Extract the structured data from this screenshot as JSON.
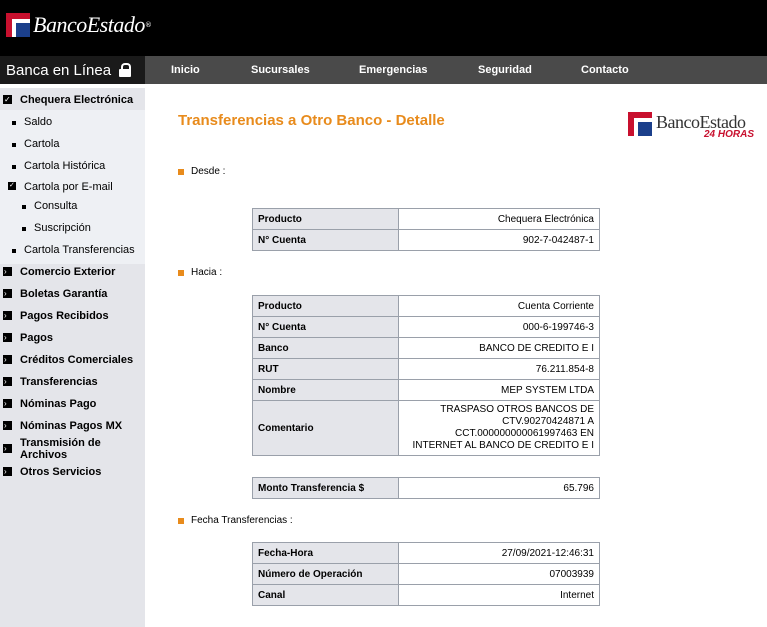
{
  "brand": {
    "name": "BancoEstado",
    "reg": "®"
  },
  "banca_en_linea": "Banca en Línea",
  "topnav": [
    "Inicio",
    "Sucursales",
    "Emergencias",
    "Seguridad",
    "Contacto"
  ],
  "sidebar": {
    "chequera": "Chequera Electrónica",
    "saldo": "Saldo",
    "cartola": "Cartola",
    "cartola_historica": "Cartola Histórica",
    "cartola_email": "Cartola por E-mail",
    "consulta": "Consulta",
    "suscripcion": "Suscripción",
    "cartola_transferencias": "Cartola Transferencias",
    "comercio_exterior": "Comercio Exterior",
    "boletas_garantia": "Boletas Garantía",
    "pagos_recibidos": "Pagos Recibidos",
    "pagos": "Pagos",
    "creditos_comerciales": "Créditos Comerciales",
    "transferencias": "Transferencias",
    "nominas_pago": "Nóminas Pago",
    "nominas_pagos_mx": "Nóminas Pagos MX",
    "transmision_archivos_1": "Transmisión de",
    "transmision_archivos_2": "Archivos",
    "otros_servicios": "Otros Servicios"
  },
  "main": {
    "title": "Transferencias a Otro Banco - Detalle",
    "logo24_name": "BancoEstado",
    "logo24_tag": "24 HORAS",
    "desde_label": "Desde :",
    "hacia_label": "Hacia :",
    "fecha_label": "Fecha Transferencias :",
    "desde": {
      "producto_k": "Producto",
      "producto_v": "Chequera Electrónica",
      "cuenta_k": "N° Cuenta",
      "cuenta_v": "902-7-042487-1"
    },
    "hacia": {
      "producto_k": "Producto",
      "producto_v": "Cuenta Corriente",
      "cuenta_k": "N° Cuenta",
      "cuenta_v": "000-6-199746-3",
      "banco_k": "Banco",
      "banco_v": "BANCO DE CREDITO E I",
      "rut_k": "RUT",
      "rut_v": "76.211.854-8",
      "nombre_k": "Nombre",
      "nombre_v": "MEP SYSTEM LTDA",
      "comentario_k": "Comentario",
      "comentario_v1": "TRASPASO OTROS BANCOS DE",
      "comentario_v2": "CTV.90270424871 A",
      "comentario_v3": "CCT.000000000061997463 EN",
      "comentario_v4": "INTERNET AL BANCO DE CREDITO E I"
    },
    "monto": {
      "k": "Monto Transferencia $",
      "v": "65.796"
    },
    "fecha": {
      "hora_k": "Fecha-Hora",
      "hora_v": "27/09/2021-12:46:31",
      "op_k": "Número de Operación",
      "op_v": "07003939",
      "canal_k": "Canal",
      "canal_v": "Internet"
    }
  }
}
